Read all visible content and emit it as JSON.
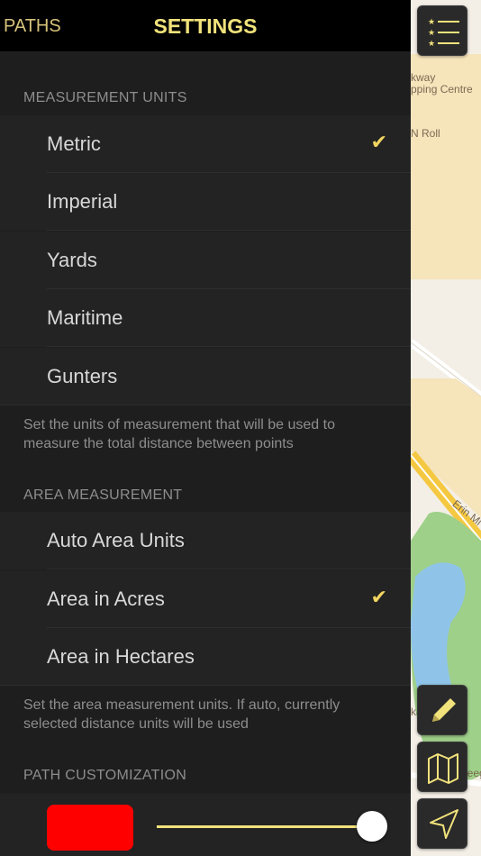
{
  "topbar": {
    "back_label": "PATHS",
    "title": "SETTINGS"
  },
  "measurement": {
    "header": "MEASUREMENT UNITS",
    "options": [
      {
        "label": "Metric",
        "selected": true
      },
      {
        "label": "Imperial",
        "selected": false
      },
      {
        "label": "Yards",
        "selected": false
      },
      {
        "label": "Maritime",
        "selected": false
      },
      {
        "label": "Gunters",
        "selected": false
      }
    ],
    "footer": "Set the units of measurement that will be used to measure the total distance between points"
  },
  "area": {
    "header": "AREA MEASUREMENT",
    "options": [
      {
        "label": "Auto Area Units",
        "selected": false
      },
      {
        "label": "Area in Acres",
        "selected": true
      },
      {
        "label": "Area in Hectares",
        "selected": false
      }
    ],
    "footer": "Set the area measurement units. If auto, currently selected distance units will be used"
  },
  "path": {
    "header": "PATH CUSTOMIZATION",
    "color": "#ff0000",
    "slider_value": 1.0
  },
  "check_glyph": "✔",
  "map": {
    "labels": [
      "kway",
      "pping Centre",
      "N Roll",
      "Erin Mi",
      "kayn",
      "Reeg"
    ]
  },
  "colors": {
    "accent": "#f1e27b",
    "panel_bg": "#1e1e1e",
    "row_bg": "#232323",
    "topbar_bg": "#000000"
  }
}
